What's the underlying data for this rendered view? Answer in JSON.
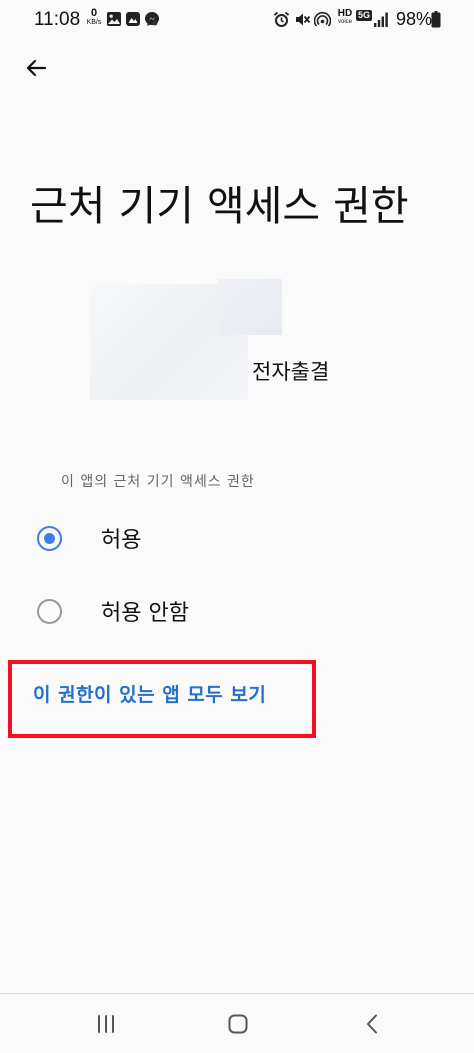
{
  "status_bar": {
    "time": "11:08",
    "network_speed_value": "0",
    "network_speed_unit": "KB/s",
    "battery_percent": "98%",
    "icons": [
      "image-icon",
      "gallery-icon",
      "messenger-icon",
      "notification-dot-icon",
      "alarm-icon",
      "mute-icon",
      "hotspot-icon",
      "hd-voice-icon",
      "5g-icon",
      "signal-icon",
      "battery-icon"
    ],
    "hd_label": "HD",
    "voice_label": "voice",
    "network_label": "5G"
  },
  "header": {
    "back_icon": "arrow-left-icon",
    "title": "근처 기기 액세스 권한"
  },
  "app": {
    "name": "전자출결"
  },
  "permission": {
    "section_header": "이 앱의 근처 기기 액세스 권한",
    "options": [
      {
        "label": "허용",
        "selected": true
      },
      {
        "label": "허용 안함",
        "selected": false
      }
    ],
    "see_all_link": "이 권한이 있는 앱 모두 보기"
  },
  "colors": {
    "accent": "#3d7ee6",
    "link": "#2270c9",
    "highlight": "#f01022",
    "background": "#fafafa"
  },
  "nav_bar": {
    "buttons": [
      "recent-apps-icon",
      "home-icon",
      "back-icon"
    ]
  }
}
